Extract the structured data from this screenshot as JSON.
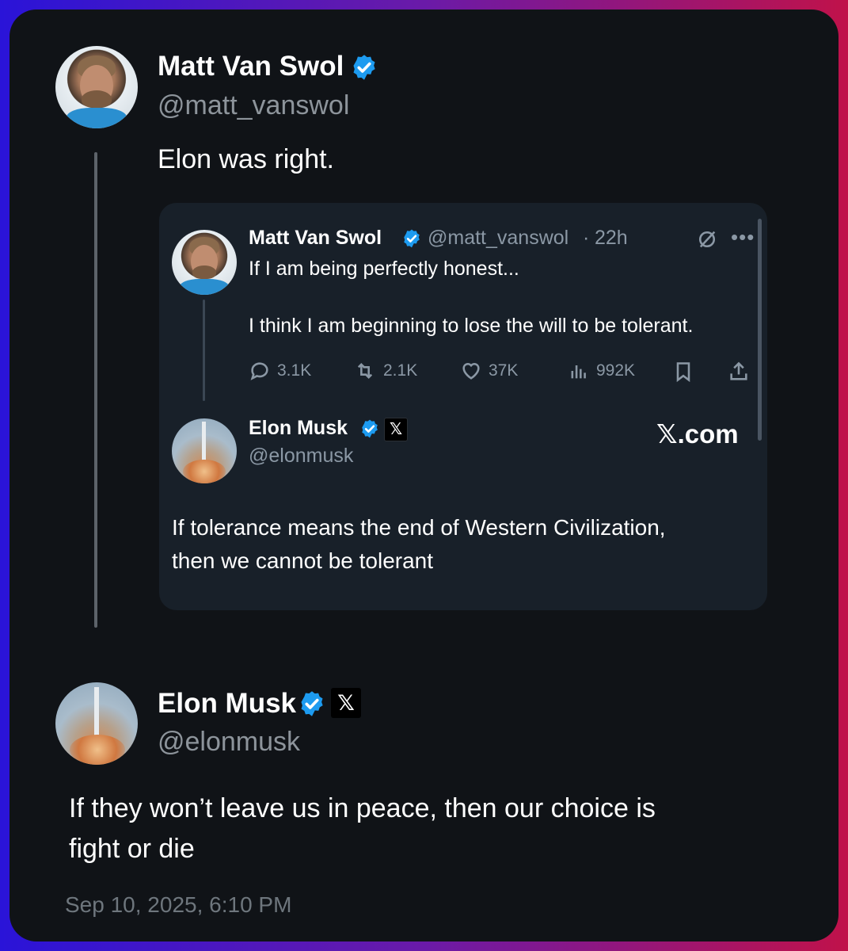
{
  "main_tweet": {
    "author_name": "Matt Van Swol",
    "author_handle": "@matt_vanswol",
    "text": "Elon was right.",
    "avatar_icon": "avatar-matt"
  },
  "quote": {
    "author_name": "Matt Van Swol",
    "author_handle": "@matt_vanswol",
    "separator": "·",
    "time": "22h",
    "line1": "If I am being perfectly honest...",
    "line2": "I think I am beginning to lose the will to be tolerant.",
    "stats": {
      "replies": "3.1K",
      "retweets": "2.1K",
      "likes": "37K",
      "views": "992K"
    },
    "reply_author_name": "Elon Musk",
    "reply_author_handle": "@elonmusk",
    "xcom_label": "𝕏.com",
    "reply_text_line1": "If tolerance means the end of Western Civilization,",
    "reply_text_line2": "then we cannot be tolerant"
  },
  "reply_tweet": {
    "author_name": "Elon Musk",
    "author_handle": "@elonmusk",
    "x_badge": "𝕏",
    "text_line1": "If they won’t leave us in peace, then our choice is",
    "text_line2": "fight or die",
    "timestamp": "Sep 10, 2025, 6:10 PM"
  },
  "colors": {
    "card_bg": "#101317",
    "quote_bg": "#182029",
    "verified_blue": "#1d9bf0",
    "muted": "#8d949b"
  }
}
